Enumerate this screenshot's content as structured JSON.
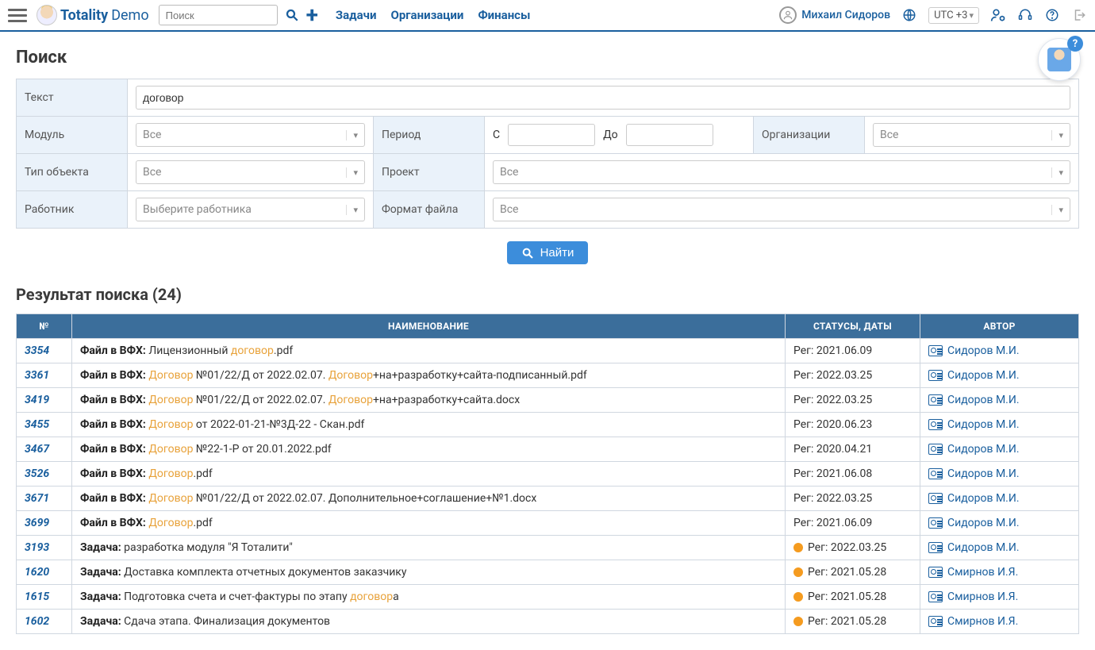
{
  "brand": {
    "name": "Totality",
    "suffix": "Demo"
  },
  "topsearch": {
    "placeholder": "Поиск"
  },
  "nav": {
    "tasks": "Задачи",
    "orgs": "Организации",
    "finance": "Финансы"
  },
  "user": {
    "name": "Михаил Сидоров",
    "tz": "UTC +3"
  },
  "page_title": "Поиск",
  "filters": {
    "text_label": "Текст",
    "text_value": "договор",
    "module_label": "Модуль",
    "module_value": "Все",
    "period_label": "Период",
    "period_from_label": "С",
    "period_to_label": "До",
    "orgs_label": "Организации",
    "orgs_value": "Все",
    "objtype_label": "Тип объекта",
    "objtype_value": "Все",
    "project_label": "Проект",
    "project_value": "Все",
    "employee_label": "Работник",
    "employee_placeholder": "Выберите работника",
    "fileformat_label": "Формат файла",
    "fileformat_value": "Все"
  },
  "search_button": "Найти",
  "results_title_prefix": "Результат поиска",
  "results_count": 24,
  "columns": {
    "no": "№",
    "name_up": "Наименование",
    "status_up": "Статусы, даты",
    "author_up": "Автор"
  },
  "highlight": "договор",
  "rows": [
    {
      "id": "3354",
      "prefix": "Файл в ВФХ:",
      "text": "Лицензионный договор.pdf",
      "status": "Рег: 2021.06.09",
      "dot": false,
      "author": "Сидоров М.И."
    },
    {
      "id": "3361",
      "prefix": "Файл в ВФХ:",
      "text": "Договор №01/22/Д от 2022.02.07. Договор+на+разработку+сайта-подписанный.pdf",
      "status": "Рег: 2022.03.25",
      "dot": false,
      "author": "Сидоров М.И."
    },
    {
      "id": "3419",
      "prefix": "Файл в ВФХ:",
      "text": "Договор №01/22/Д от 2022.02.07. Договор+на+разработку+сайта.docx",
      "status": "Рег: 2022.03.25",
      "dot": false,
      "author": "Сидоров М.И."
    },
    {
      "id": "3455",
      "prefix": "Файл в ВФХ:",
      "text": "Договор от 2022-01-21-№3Д-22 - Скан.pdf",
      "status": "Рег: 2020.06.23",
      "dot": false,
      "author": "Сидоров М.И."
    },
    {
      "id": "3467",
      "prefix": "Файл в ВФХ:",
      "text": "Договор №22-1-Р от 20.01.2022.pdf",
      "status": "Рег: 2020.04.21",
      "dot": false,
      "author": "Сидоров М.И."
    },
    {
      "id": "3526",
      "prefix": "Файл в ВФХ:",
      "text": "Договор.pdf",
      "status": "Рег: 2021.06.08",
      "dot": false,
      "author": "Сидоров М.И."
    },
    {
      "id": "3671",
      "prefix": "Файл в ВФХ:",
      "text": "Договор №01/22/Д от 2022.02.07. Дополнительное+соглашение+№1.docx",
      "status": "Рег: 2022.03.25",
      "dot": false,
      "author": "Сидоров М.И."
    },
    {
      "id": "3699",
      "prefix": "Файл в ВФХ:",
      "text": "Договор.pdf",
      "status": "Рег: 2021.06.09",
      "dot": false,
      "author": "Сидоров М.И."
    },
    {
      "id": "3193",
      "prefix": "Задача:",
      "text": "разработка модуля \"Я Тоталити\"",
      "status": "Рег: 2022.03.25",
      "dot": true,
      "author": "Сидоров М.И."
    },
    {
      "id": "1620",
      "prefix": "Задача:",
      "text": "Доставка комплекта отчетных документов заказчику",
      "status": "Рег: 2021.05.28",
      "dot": true,
      "author": "Смирнов И.Я."
    },
    {
      "id": "1615",
      "prefix": "Задача:",
      "text": "Подготовка счета и счет-фактуры по этапу договора",
      "status": "Рег: 2021.05.28",
      "dot": true,
      "author": "Смирнов И.Я."
    },
    {
      "id": "1602",
      "prefix": "Задача:",
      "text": "Сдача этапа. Финализация документов",
      "status": "Рег: 2021.05.28",
      "dot": true,
      "author": "Смирнов И.Я."
    }
  ]
}
